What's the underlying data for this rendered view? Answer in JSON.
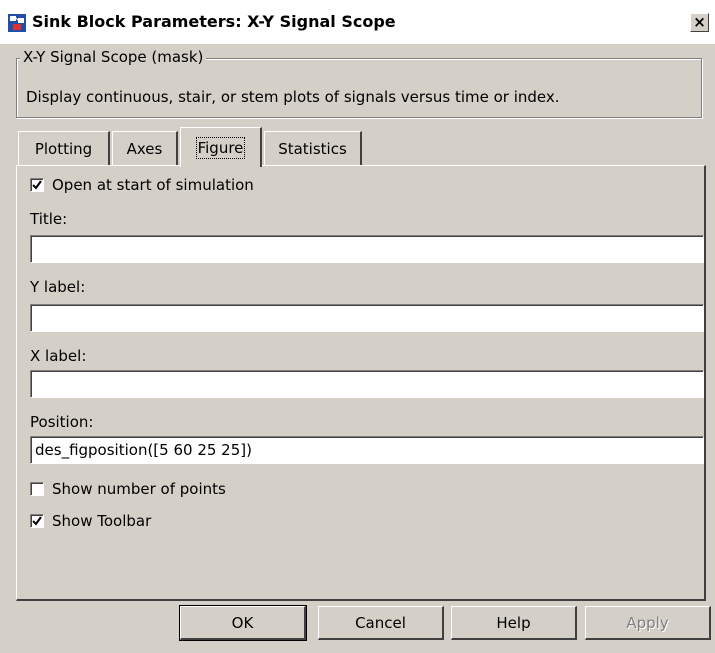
{
  "window": {
    "title": "Sink Block Parameters: X-Y Signal Scope",
    "icon": "simulink-block-icon",
    "close_label": "×"
  },
  "mask": {
    "legend": "X-Y Signal Scope (mask)",
    "description": "Display continuous, stair, or stem plots of signals versus time or index."
  },
  "tabs": [
    {
      "label": "Plotting"
    },
    {
      "label": "Axes"
    },
    {
      "label": "Figure"
    },
    {
      "label": "Statistics"
    }
  ],
  "active_tab": "Figure",
  "figure": {
    "open_at_start": {
      "label": "Open at start of simulation",
      "checked": true
    },
    "title": {
      "label": "Title:",
      "value": ""
    },
    "ylabel": {
      "label": "Y label:",
      "value": ""
    },
    "xlabel": {
      "label": "X label:",
      "value": ""
    },
    "position": {
      "label": "Position:",
      "value": "des_figposition([5 60 25 25])"
    },
    "show_points": {
      "label": "Show number of points",
      "checked": false
    },
    "show_toolbar": {
      "label": "Show Toolbar",
      "checked": true
    }
  },
  "buttons": {
    "ok": "OK",
    "cancel": "Cancel",
    "help": "Help",
    "apply": "Apply"
  },
  "colors": {
    "face": "#d4d0c8",
    "title_bg": "#ffffff"
  }
}
